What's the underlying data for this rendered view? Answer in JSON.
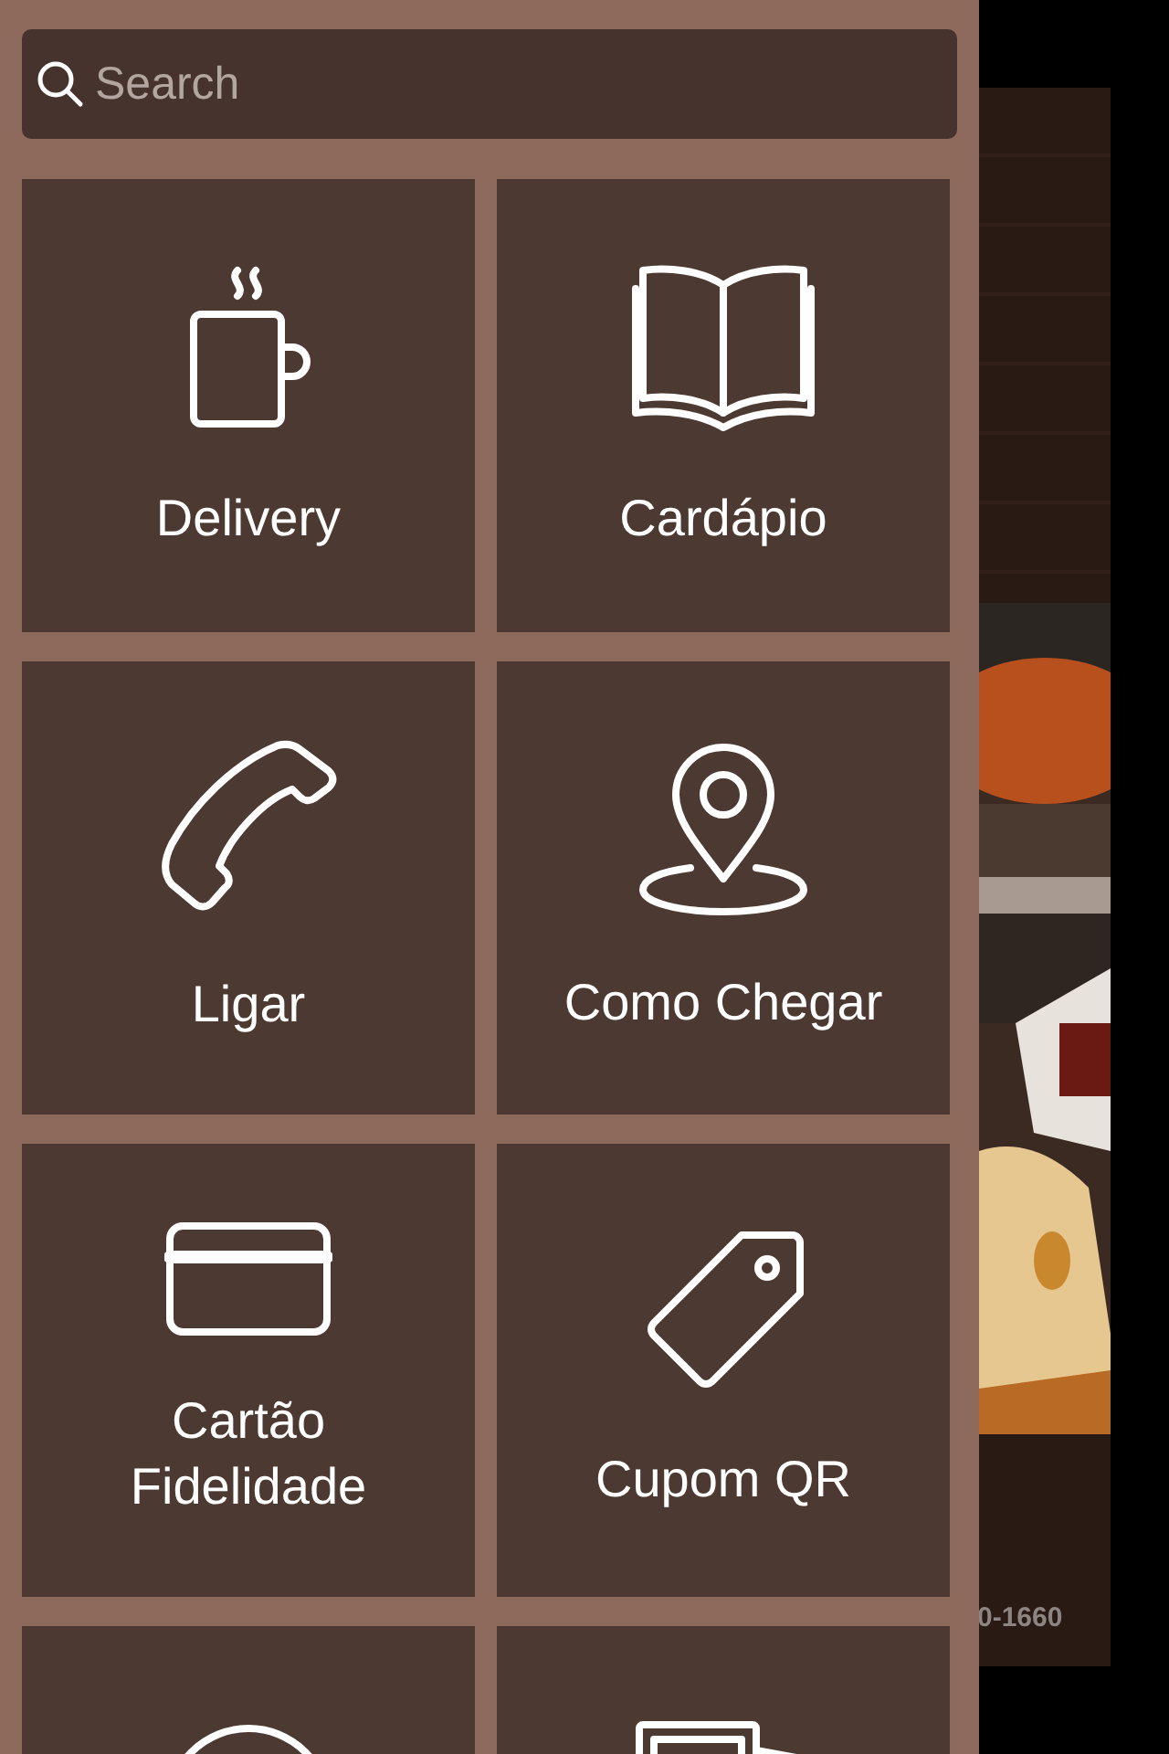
{
  "search": {
    "placeholder": "Search"
  },
  "tiles": [
    {
      "kind": "cup",
      "label": "Delivery"
    },
    {
      "kind": "book",
      "label": "Cardápio"
    },
    {
      "kind": "phone",
      "label": "Ligar"
    },
    {
      "kind": "pin",
      "label": "Como Chegar"
    },
    {
      "kind": "card",
      "label": "Cartão Fidelidade"
    },
    {
      "kind": "tag",
      "label": "Cupom QR"
    },
    {
      "kind": "chat"
    },
    {
      "kind": "photos"
    }
  ],
  "background_app": {
    "phone_fragment": "0-1660"
  }
}
